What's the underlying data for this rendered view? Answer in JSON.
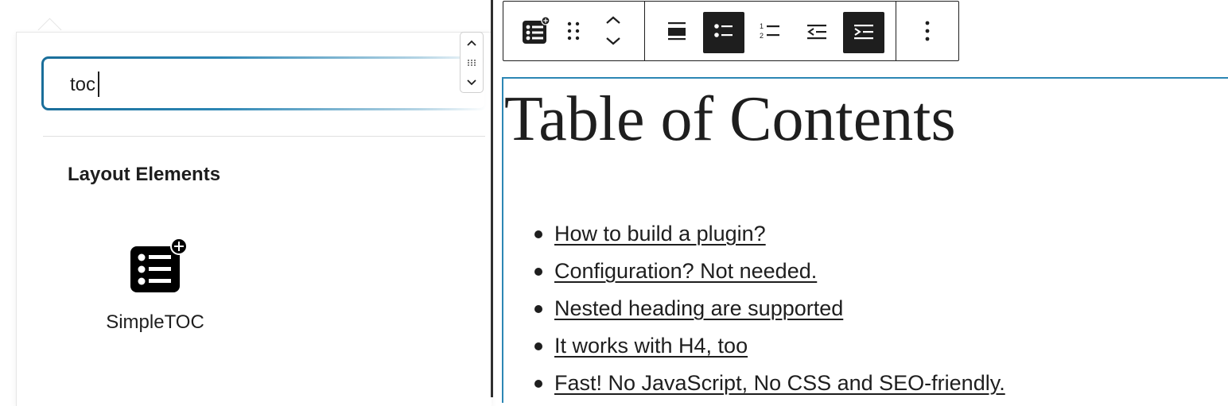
{
  "inserter": {
    "search": {
      "value": "toc",
      "placeholder": ""
    },
    "group_title": "Layout Elements",
    "results": [
      {
        "label": "SimpleTOC",
        "icon": "list-plus-icon"
      }
    ]
  },
  "toolbar": {
    "buttons": [
      {
        "name": "block-type",
        "icon": "list-plus-icon"
      },
      {
        "name": "drag",
        "icon": "drag-handle-icon"
      },
      {
        "name": "move",
        "icon": "chevron-up-down-icon"
      },
      {
        "name": "align",
        "icon": "align-icon"
      },
      {
        "name": "unordered-list",
        "icon": "unordered-list-icon",
        "active": true
      },
      {
        "name": "ordered-list",
        "icon": "ordered-list-icon"
      },
      {
        "name": "outdent",
        "icon": "outdent-icon"
      },
      {
        "name": "indent",
        "icon": "indent-icon",
        "active": true
      },
      {
        "name": "more",
        "icon": "more-vertical-icon"
      }
    ]
  },
  "content": {
    "heading": "Table of Contents",
    "items": [
      "How to build a plugin?",
      "Configuration? Not needed.",
      "Nested heading are supported",
      "It works with H4, too",
      "Fast! No JavaScript, No CSS and SEO-friendly."
    ]
  },
  "colors": {
    "accent": "#2c86b4",
    "text": "#1e1e1e",
    "active_button": "#1e1e1e"
  }
}
